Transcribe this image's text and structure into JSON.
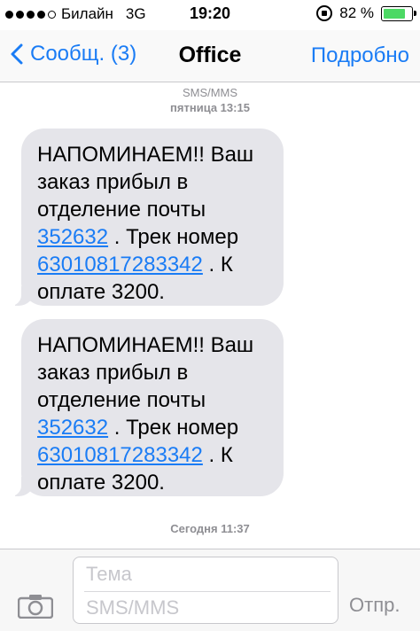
{
  "status": {
    "carrier": "Билайн",
    "network": "3G",
    "time": "19:20",
    "battery_text": "82 %",
    "battery_level": 0.82
  },
  "nav": {
    "back_label": "Сообщ. (3)",
    "title": "Office",
    "details_label": "Подробно"
  },
  "thread": {
    "service": "SMS/MMS",
    "day_time": "пятница 13:15",
    "today_time": "Сегодня 11:37",
    "messages": [
      {
        "line1": "НАПОМИНАЕМ!! Ваш",
        "line2": "заказ прибыл в",
        "line3": "отделение почты",
        "postcode": "352632",
        "track_label": ". Трек номер",
        "track": "63010817283342",
        "after_track": ". К",
        "amount": "оплате 3200."
      },
      {
        "line1": "НАПОМИНАЕМ!! Ваш",
        "line2": "заказ прибыл в",
        "line3": "отделение почты",
        "postcode": "352632",
        "track_label": ". Трек номер",
        "track": "63010817283342",
        "after_track": ". К",
        "amount": "оплате 3200."
      }
    ]
  },
  "composer": {
    "subject_placeholder": "Тема",
    "body_placeholder": "SMS/MMS",
    "send_label": "Отпр."
  },
  "colors": {
    "accent": "#1a7cf5",
    "bubble": "#e5e5ea",
    "battery": "#4cd964"
  },
  "icons": [
    "lock-rotation-icon",
    "battery-icon",
    "back-chevron-icon",
    "camera-icon"
  ]
}
